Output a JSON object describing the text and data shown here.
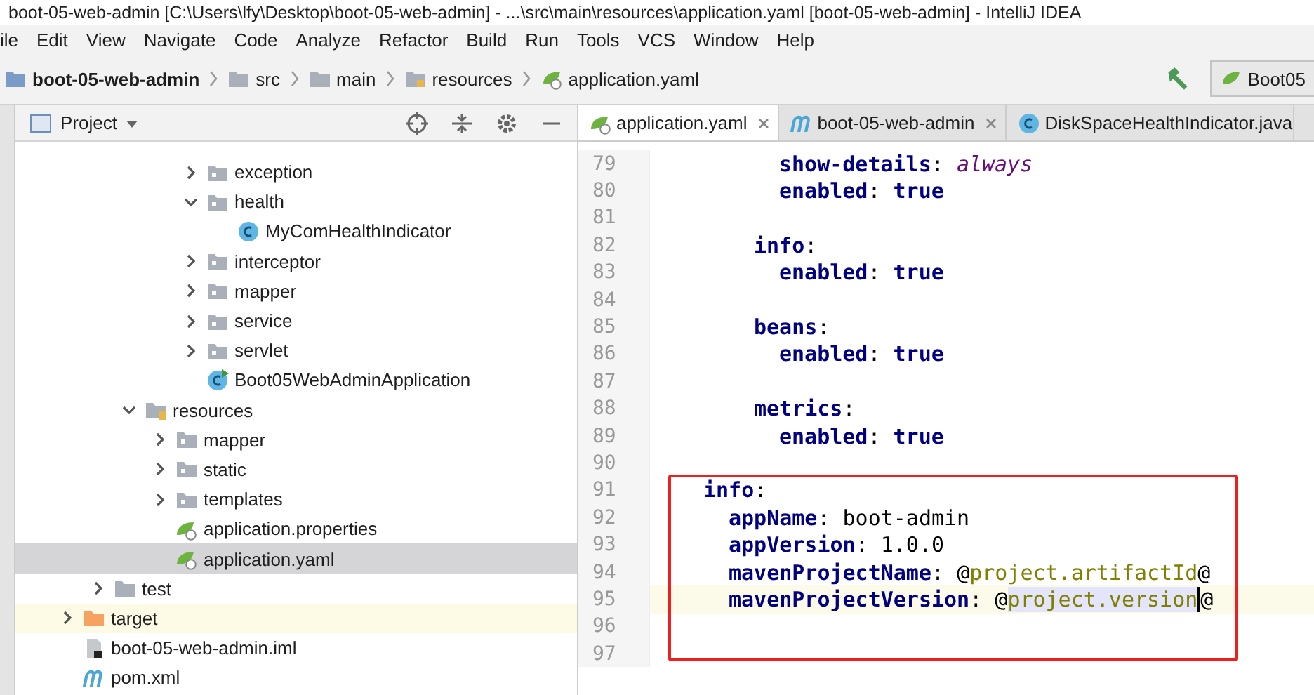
{
  "window": {
    "title": "boot-05-web-admin [C:\\Users\\lfy\\Desktop\\boot-05-web-admin] - ...\\src\\main\\resources\\application.yaml [boot-05-web-admin] - IntelliJ IDEA"
  },
  "menu": [
    "ile",
    "Edit",
    "View",
    "Navigate",
    "Code",
    "Analyze",
    "Refactor",
    "Build",
    "Run",
    "Tools",
    "VCS",
    "Window",
    "Help"
  ],
  "breadcrumbs": [
    {
      "label": "boot-05-web-admin",
      "kind": "project"
    },
    {
      "label": "src",
      "kind": "folder"
    },
    {
      "label": "main",
      "kind": "folder"
    },
    {
      "label": "resources",
      "kind": "resources"
    },
    {
      "label": "application.yaml",
      "kind": "spring"
    }
  ],
  "run_config": "Boot05",
  "project_panel": {
    "title": "Project"
  },
  "tree": [
    {
      "children": [
        {
          "children": [
            {
              "children": [
                {
                  "children": [
                    {
                      "label": "exception",
                      "kind": "folder",
                      "expanded": false,
                      "selected": false
                    },
                    {
                      "label": "health",
                      "kind": "folder",
                      "expanded": true,
                      "selected": false,
                      "children": [
                        {
                          "label": "MyComHealthIndicator",
                          "kind": "class",
                          "selected": false
                        }
                      ]
                    },
                    {
                      "label": "interceptor",
                      "kind": "folder",
                      "expanded": false,
                      "selected": false
                    },
                    {
                      "label": "mapper",
                      "kind": "folder",
                      "expanded": false,
                      "selected": false
                    },
                    {
                      "label": "service",
                      "kind": "folder",
                      "expanded": false,
                      "selected": false
                    },
                    {
                      "label": "servlet",
                      "kind": "folder",
                      "expanded": false,
                      "selected": false
                    },
                    {
                      "label": "Boot05WebAdminApplication",
                      "kind": "boot-class",
                      "selected": false
                    }
                  ]
                }
              ]
            },
            {
              "label": "resources",
              "kind": "resources",
              "expanded": true,
              "selected": false,
              "children": [
                {
                  "label": "mapper",
                  "kind": "folder",
                  "expanded": false,
                  "selected": false
                },
                {
                  "label": "static",
                  "kind": "folder",
                  "expanded": false,
                  "selected": false
                },
                {
                  "label": "templates",
                  "kind": "folder",
                  "expanded": false,
                  "selected": false
                },
                {
                  "label": "application.properties",
                  "kind": "spring",
                  "selected": false
                },
                {
                  "label": "application.yaml",
                  "kind": "spring",
                  "selected": true
                }
              ]
            }
          ]
        },
        {
          "label": "test",
          "kind": "folder-plain",
          "expanded": false,
          "selected": false
        }
      ]
    },
    {
      "label": "target",
      "kind": "excluded",
      "expanded": false,
      "selected": false
    },
    {
      "label": "boot-05-web-admin.iml",
      "kind": "iml",
      "selected": false
    },
    {
      "label": "pom.xml",
      "kind": "maven",
      "selected": false
    }
  ],
  "editor_tabs": [
    {
      "label": "application.yaml",
      "kind": "spring",
      "selected": true,
      "closable": true
    },
    {
      "label": "boot-05-web-admin",
      "kind": "maven",
      "selected": false,
      "closable": true
    },
    {
      "label": "DiskSpaceHealthIndicator.java",
      "kind": "class",
      "selected": false,
      "closable": false
    }
  ],
  "code_lines": [
    {
      "children": [
        {
          "children": [
            {
              "children": [
                {
                  "number": "79",
                  "current": false,
                  "tokens": [
                    {
                      "text": "show-details",
                      "kind": "key"
                    },
                    {
                      "text": ": ",
                      "kind": "punct"
                    },
                    {
                      "text": "always",
                      "kind": "italic"
                    }
                  ]
                },
                {
                  "number": "80",
                  "current": false,
                  "tokens": [
                    {
                      "text": "enabled",
                      "kind": "key"
                    },
                    {
                      "text": ": ",
                      "kind": "punct"
                    },
                    {
                      "text": "true",
                      "kind": "keyword"
                    }
                  ]
                }
              ]
            },
            {
              "number": "81",
              "current": false
            },
            {
              "number": "82",
              "current": false,
              "tokens": [
                {
                  "text": "info",
                  "kind": "key"
                },
                {
                  "text": ":",
                  "kind": "punct"
                }
              ],
              "children": [
                {
                  "number": "83",
                  "current": false,
                  "tokens": [
                    {
                      "text": "enabled",
                      "kind": "key"
                    },
                    {
                      "text": ": ",
                      "kind": "punct"
                    },
                    {
                      "text": "true",
                      "kind": "keyword"
                    }
                  ]
                }
              ]
            },
            {
              "number": "84",
              "current": false
            },
            {
              "number": "85",
              "current": false,
              "tokens": [
                {
                  "text": "beans",
                  "kind": "key"
                },
                {
                  "text": ":",
                  "kind": "punct"
                }
              ],
              "children": [
                {
                  "number": "86",
                  "current": false,
                  "tokens": [
                    {
                      "text": "enabled",
                      "kind": "key"
                    },
                    {
                      "text": ": ",
                      "kind": "punct"
                    },
                    {
                      "text": "true",
                      "kind": "keyword"
                    }
                  ]
                }
              ]
            },
            {
              "number": "87",
              "current": false
            },
            {
              "number": "88",
              "current": false,
              "tokens": [
                {
                  "text": "metrics",
                  "kind": "key"
                },
                {
                  "text": ":",
                  "kind": "punct"
                }
              ],
              "children": [
                {
                  "number": "89",
                  "current": false,
                  "tokens": [
                    {
                      "text": "enabled",
                      "kind": "key"
                    },
                    {
                      "text": ": ",
                      "kind": "punct"
                    },
                    {
                      "text": "true",
                      "kind": "keyword"
                    }
                  ]
                }
              ]
            }
          ]
        }
      ]
    },
    {
      "number": "90",
      "current": false
    },
    {
      "number": "91",
      "current": false,
      "tokens": [
        {
          "text": "info",
          "kind": "key"
        },
        {
          "text": ":",
          "kind": "punct"
        }
      ],
      "children": [
        {
          "number": "92",
          "current": false,
          "tokens": [
            {
              "text": "appName",
              "kind": "key"
            },
            {
              "text": ": ",
              "kind": "punct"
            },
            {
              "text": "boot-admin",
              "kind": "value"
            }
          ]
        },
        {
          "number": "93",
          "current": false,
          "tokens": [
            {
              "text": "appVersion",
              "kind": "key"
            },
            {
              "text": ": ",
              "kind": "punct"
            },
            {
              "text": "1.0.0",
              "kind": "value"
            }
          ]
        },
        {
          "number": "94",
          "current": false,
          "tokens": [
            {
              "text": "mavenProjectName",
              "kind": "key"
            },
            {
              "text": ": ",
              "kind": "punct"
            },
            {
              "text": "@",
              "kind": "value"
            },
            {
              "text": "project.artifactId",
              "kind": "placeholder"
            },
            {
              "text": "@",
              "kind": "value"
            }
          ]
        },
        {
          "number": "95",
          "current": true,
          "tokens": [
            {
              "text": "mavenProjectVersion",
              "kind": "key"
            },
            {
              "text": ": ",
              "kind": "punct"
            },
            {
              "text": "@",
              "kind": "value"
            },
            {
              "text": "project.version",
              "kind": "selection"
            },
            {
              "text": "@",
              "kind": "value"
            }
          ]
        }
      ]
    },
    {
      "number": "96",
      "current": false
    },
    {
      "number": "97",
      "current": false
    }
  ]
}
